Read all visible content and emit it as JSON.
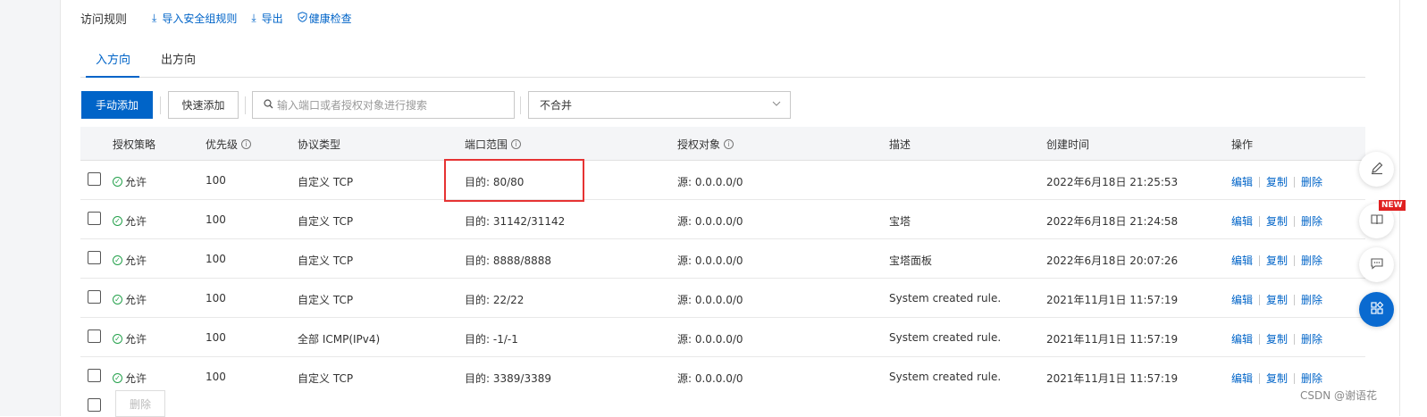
{
  "header": {
    "title": "访问规则",
    "import_label": "导入安全组规则",
    "export_label": "导出",
    "health_label": "健康检查"
  },
  "tabs": [
    {
      "label": "入方向",
      "active": true
    },
    {
      "label": "出方向",
      "active": false
    }
  ],
  "toolbar": {
    "manual_add": "手动添加",
    "quick_add": "快速添加",
    "search_placeholder": "输入端口或者授权对象进行搜索",
    "merge_select": "不合并"
  },
  "table": {
    "columns": [
      "授权策略",
      "优先级",
      "协议类型",
      "端口范围",
      "授权对象",
      "描述",
      "创建时间",
      "操作"
    ],
    "rows": [
      {
        "policy": "允许",
        "priority": "100",
        "protocol": "自定义 TCP",
        "port": "目的: 80/80",
        "source": "源: 0.0.0.0/0",
        "desc": "",
        "created": "2022年6月18日 21:25:53"
      },
      {
        "policy": "允许",
        "priority": "100",
        "protocol": "自定义 TCP",
        "port": "目的: 31142/31142",
        "source": "源: 0.0.0.0/0",
        "desc": "宝塔",
        "created": "2022年6月18日 21:24:58"
      },
      {
        "policy": "允许",
        "priority": "100",
        "protocol": "自定义 TCP",
        "port": "目的: 8888/8888",
        "source": "源: 0.0.0.0/0",
        "desc": "宝塔面板",
        "created": "2022年6月18日 20:07:26"
      },
      {
        "policy": "允许",
        "priority": "100",
        "protocol": "自定义 TCP",
        "port": "目的: 22/22",
        "source": "源: 0.0.0.0/0",
        "desc": "System created rule.",
        "created": "2021年11月1日 11:57:19"
      },
      {
        "policy": "允许",
        "priority": "100",
        "protocol": "全部 ICMP(IPv4)",
        "port": "目的: -1/-1",
        "source": "源: 0.0.0.0/0",
        "desc": "System created rule.",
        "created": "2021年11月1日 11:57:19"
      },
      {
        "policy": "允许",
        "priority": "100",
        "protocol": "自定义 TCP",
        "port": "目的: 3389/3389",
        "source": "源: 0.0.0.0/0",
        "desc": "System created rule.",
        "created": "2021年11月1日 11:57:19"
      }
    ],
    "actions": {
      "edit": "编辑",
      "copy": "复制",
      "delete": "删除"
    }
  },
  "bottom": {
    "delete_label": "删除"
  },
  "float": {
    "new_badge": "NEW"
  },
  "watermark": "CSDN @谢语花",
  "colors": {
    "accent": "#0064c8",
    "allow": "#23a04a",
    "highlight": "#e63333"
  },
  "icons": [
    "import-icon",
    "export-icon",
    "shield-check-icon",
    "search-icon",
    "chevron-down-icon",
    "info-icon",
    "check-circle-icon",
    "edit-pen-icon",
    "book-icon",
    "chat-icon",
    "apps-icon"
  ]
}
